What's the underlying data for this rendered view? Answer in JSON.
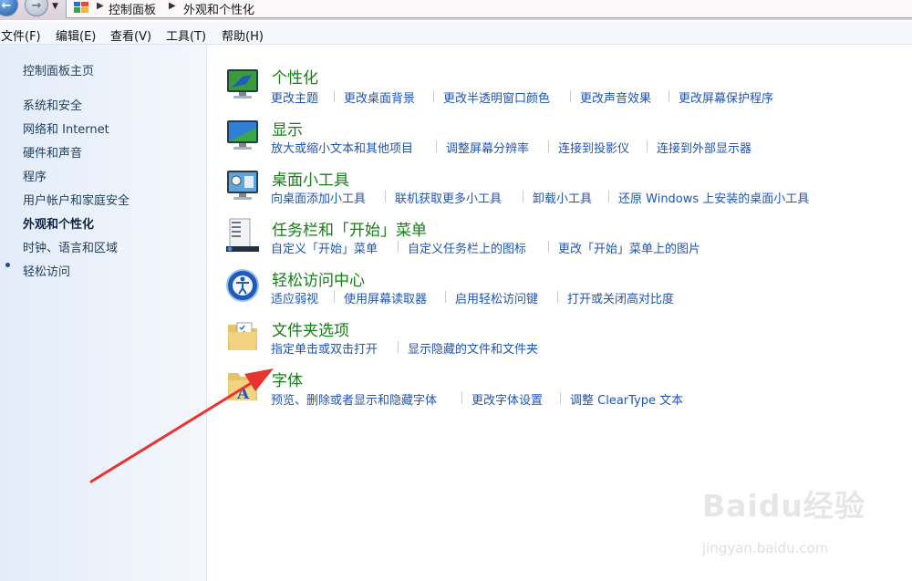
{
  "address_bar": {
    "breadcrumb": [
      "控制面板",
      "外观和个性化"
    ]
  },
  "menu": [
    "文件(F)",
    "编辑(E)",
    "查看(V)",
    "工具(T)",
    "帮助(H)"
  ],
  "left_nav": {
    "home": "控制面板主页",
    "items": [
      "系统和安全",
      "网络和 Internet",
      "硬件和声音",
      "程序",
      "用户帐户和家庭安全",
      "外观和个性化",
      "时钟、语言和区域",
      "轻松访问"
    ],
    "current_index": 5
  },
  "categories": [
    {
      "title": "个性化",
      "icon": "personalization-monitor-icon",
      "tasks": [
        "更改主题",
        "更改桌面背景",
        "更改半透明窗口颜色",
        "更改声音效果",
        "更改屏幕保护程序"
      ]
    },
    {
      "title": "显示",
      "icon": "display-monitor-icon",
      "tasks": [
        "放大或缩小文本和其他项目",
        "调整屏幕分辨率",
        "连接到投影仪",
        "连接到外部显示器"
      ]
    },
    {
      "title": "桌面小工具",
      "icon": "desktop-gadgets-icon",
      "tasks": [
        "向桌面添加小工具",
        "联机获取更多小工具",
        "卸载小工具",
        "还原 Windows 上安装的桌面小工具"
      ]
    },
    {
      "title": "任务栏和「开始」菜单",
      "icon": "taskbar-start-menu-icon",
      "tasks": [
        "自定义「开始」菜单",
        "自定义任务栏上的图标",
        "更改「开始」菜单上的图片"
      ]
    },
    {
      "title": "轻松访问中心",
      "icon": "ease-of-access-icon",
      "tasks": [
        "适应弱视",
        "使用屏幕读取器",
        "启用轻松访问键",
        "打开或关闭高对比度"
      ]
    },
    {
      "title": "文件夹选项",
      "icon": "folder-options-icon",
      "tasks": [
        "指定单击或双击打开",
        "显示隐藏的文件和文件夹"
      ]
    },
    {
      "title": "字体",
      "icon": "fonts-folder-icon",
      "tasks": [
        "预览、删除或者显示和隐藏字体",
        "更改字体设置",
        "调整 ClearType 文本"
      ]
    }
  ],
  "overlay": {
    "annotation_arrow_color": "#e8342f",
    "watermark_logo": "Baidu经验",
    "watermark_url": "jingyan.baidu.com"
  },
  "colors": {
    "category_title": "#157d15",
    "task_link": "#1f55b4",
    "nav_link": "#1e3d5c"
  }
}
